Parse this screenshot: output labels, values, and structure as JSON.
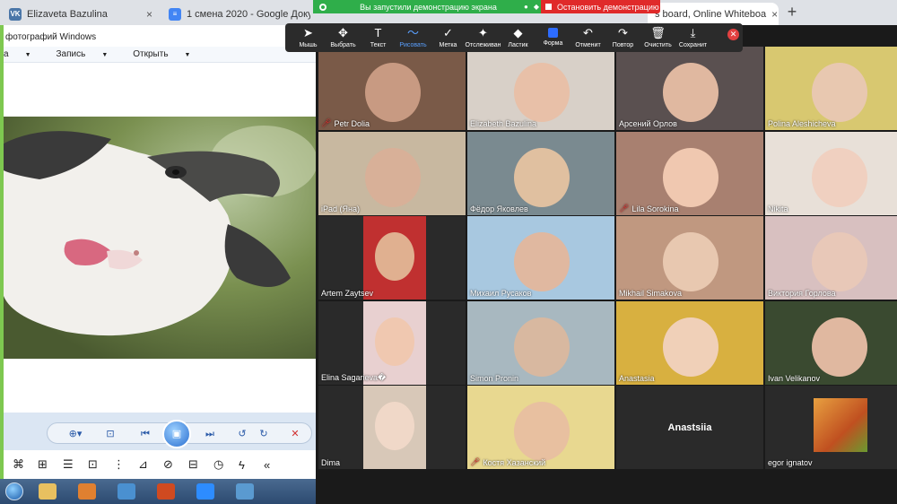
{
  "browser": {
    "tabs": [
      {
        "label": "Elizaveta Bazulina",
        "icon": "vk-icon",
        "color": "#4a76a8",
        "glyph": "VK"
      },
      {
        "label": "1 смена 2020 - Google Докуме",
        "icon": "docs-icon",
        "color": "#4285f4",
        "glyph": "≡"
      },
      {
        "label": "s board, Online Whiteboa",
        "icon": "whiteboard-icon",
        "color": "#888888",
        "glyph": ""
      }
    ],
    "new_tab_label": "+"
  },
  "share_banner": {
    "text": "Вы запустили демонстрацию экрана",
    "stop_label": "Остановить демонстрацию"
  },
  "annotation_toolbar": {
    "tools": [
      {
        "label": "Мышь",
        "icon": "cursor-icon",
        "glyph": "➤"
      },
      {
        "label": "Выбрать",
        "icon": "move-icon",
        "glyph": "✥"
      },
      {
        "label": "Текст",
        "icon": "text-icon",
        "glyph": "T"
      },
      {
        "label": "Рисовать",
        "icon": "draw-icon",
        "glyph": "〜",
        "selected": true
      },
      {
        "label": "Метка",
        "icon": "stamp-icon",
        "glyph": "✓"
      },
      {
        "label": "Отслеживан",
        "icon": "spotlight-icon",
        "glyph": "✦"
      },
      {
        "label": "Ластик",
        "icon": "eraser-icon",
        "glyph": "◆"
      },
      {
        "label": "Форма",
        "icon": "shape-icon",
        "glyph": ""
      },
      {
        "label": "Отменит",
        "icon": "undo-icon",
        "glyph": "↶"
      },
      {
        "label": "Повтор",
        "icon": "redo-icon",
        "glyph": "↷"
      },
      {
        "label": "Очистить",
        "icon": "trash-icon",
        "glyph": "🗑"
      },
      {
        "label": "Сохранит",
        "icon": "save-icon",
        "glyph": "⤓"
      }
    ],
    "accent": "#5aa0ff"
  },
  "photo_viewer": {
    "title": "фотографий Windows",
    "menu": [
      {
        "label": "а"
      },
      {
        "label": "Запись"
      },
      {
        "label": "Открыть"
      }
    ],
    "controls": {
      "zoom": "⊕▾",
      "fit": "⊡",
      "prev": "⏮",
      "slideshow": "▣",
      "next": "⏭",
      "rotate_left": "↺",
      "rotate_right": "↻",
      "delete": "✕"
    },
    "bottom_tools": [
      "⌘",
      "⊞",
      "☰",
      "⊡",
      "⋮",
      "⊿",
      "⊘",
      "⊟",
      "◷",
      "ϟ",
      "«"
    ]
  },
  "participants": [
    {
      "name": "Petr Dolia",
      "muted": true,
      "bg": "#7a5a48",
      "face": "#c89a82"
    },
    {
      "name": "Elizabeth Bazulina",
      "muted": false,
      "active": true,
      "bg": "#d8d0c8",
      "face": "#e8c0a8"
    },
    {
      "name": "Арсений Орлов",
      "muted": false,
      "bg": "#5a5050",
      "face": "#e0b8a0"
    },
    {
      "name": "Polina  Aleshicheva",
      "muted": false,
      "bg": "#d8c870",
      "face": "#e8c8b0"
    },
    {
      "name": "iPad (Яна)",
      "muted": false,
      "bg": "#c8b8a0",
      "face": "#d8b098"
    },
    {
      "name": "Фёдор Яковлев",
      "muted": false,
      "bg": "#7a8a90",
      "face": "#e0c0a0"
    },
    {
      "name": "Lila Sorokina",
      "muted": true,
      "bg": "#a88070",
      "face": "#f0c8b0"
    },
    {
      "name": "Nikita",
      "muted": false,
      "bg": "#e8e0d8",
      "face": "#f0d0c0"
    },
    {
      "name": "Artem Zaytsev",
      "muted": false,
      "bg": "#c03030",
      "face": "#e0b090"
    },
    {
      "name": "Михаил Русаков",
      "muted": false,
      "bg": "#a8c8e0",
      "face": "#e0b8a0"
    },
    {
      "name": "Mikhail Simakova",
      "muted": false,
      "bg": "#c09880",
      "face": "#e8c8b0"
    },
    {
      "name": "Виктория Горлова",
      "muted": false,
      "bg": "#d8c0c0",
      "face": "#e8c8b8"
    },
    {
      "name": "Elina Sagarieva�",
      "muted": false,
      "bg": "#e8d0d0",
      "face": "#f0c8b0"
    },
    {
      "name": "Simon Pronin",
      "muted": false,
      "bg": "#a8b8c0",
      "face": "#d8b8a0"
    },
    {
      "name": "Anastasia",
      "muted": false,
      "bg": "#d8b040",
      "face": "#f0d0b8"
    },
    {
      "name": "Ivan Velikanov",
      "muted": false,
      "bg": "#3a4a30",
      "face": "#e0b8a0"
    },
    {
      "name": "Dima",
      "muted": false,
      "bg": "#d8c8b8",
      "face": "#f0d8c8"
    },
    {
      "name": "Костя Хазанский",
      "muted": true,
      "bg": "#e8d890",
      "face": "#e8c0a0"
    },
    {
      "name": "",
      "label_center": "Anastsiia",
      "muted": false,
      "bg": "#2a2a2a",
      "face": ""
    },
    {
      "name": "egor ignatov",
      "muted": false,
      "bg": "#2a2a2a",
      "face": "",
      "thumb": "#d89040"
    }
  ],
  "taskbar": {
    "items": [
      {
        "icon": "explorer-icon",
        "color": "#e8c060"
      },
      {
        "icon": "media-player-icon",
        "color": "#e08030"
      },
      {
        "icon": "chrome-icon",
        "color": "#4a90d0"
      },
      {
        "icon": "powerpoint-icon",
        "color": "#d04a20"
      },
      {
        "icon": "zoom-icon",
        "color": "#2d8cff"
      },
      {
        "icon": "photo-viewer-icon",
        "color": "#5a9ad0"
      }
    ]
  }
}
